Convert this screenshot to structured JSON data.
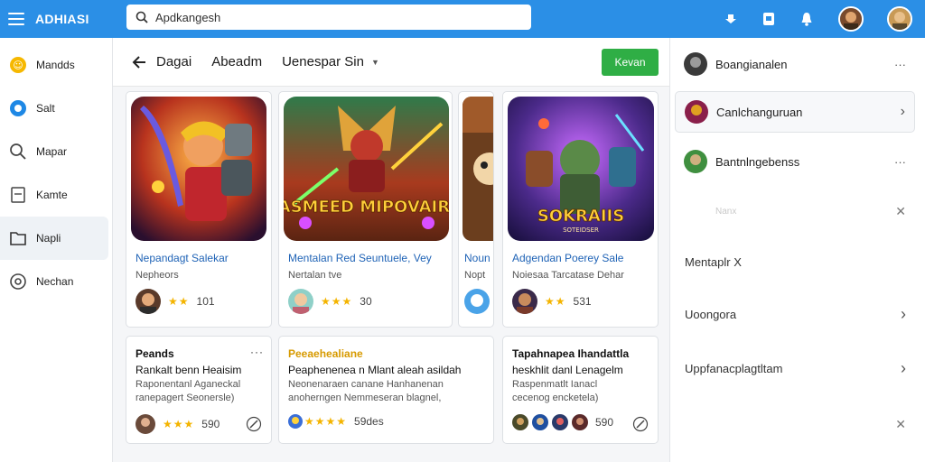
{
  "app": {
    "title": "ADHIASI"
  },
  "search": {
    "value": "Apdkangesh"
  },
  "sidebar": {
    "items": [
      {
        "label": "Mandds",
        "icon": "coin-icon"
      },
      {
        "label": "Salt",
        "icon": "compass-icon"
      },
      {
        "label": "Mapar",
        "icon": "search-icon"
      },
      {
        "label": "Kamte",
        "icon": "document-icon"
      },
      {
        "label": "Napli",
        "icon": "folder-icon"
      },
      {
        "label": "Nechan",
        "icon": "target-icon"
      }
    ]
  },
  "header": {
    "tabs": [
      "Dagai",
      "Abeadm",
      "Uenespar Sin"
    ],
    "cta": "Kevan"
  },
  "cards": [
    {
      "title": "Nepandagt Salekar",
      "subtitle": "Nepheors",
      "stars": "★★",
      "rating": "101"
    },
    {
      "title": "Mentalan Red Seuntuele, Vey",
      "subtitle": "Nertalan tve",
      "stars": "★★★",
      "rating": "30",
      "art_text": "JASMEED MIPOVAIRS"
    },
    {
      "title": "Noun",
      "subtitle": "Nopt",
      "stars": "",
      "rating": ""
    },
    {
      "title": "Adgendan Poerey Sale",
      "subtitle": "Noiesaa Tarcatase Dehar",
      "stars": "★★",
      "rating": "531",
      "art_text": "SOKRAIIS",
      "art_sub": "SOTEIDSER"
    }
  ],
  "posts": [
    {
      "title": "Peands",
      "line": "Rankalt benn Heaisim",
      "desc1": "Raponentanl Aganeckal",
      "desc2": "ranepagert Seonersle)",
      "stars": "★★★",
      "rating": "590"
    },
    {
      "title": "Peeaehealiane",
      "line": "Peaphenenea n Mlant aleah asildah",
      "desc1": "Neonenaraen canane Hanhanenan",
      "desc2": "anoherngen Nemmeseran blagnel,",
      "stars": "★★★★",
      "rating": "59des"
    },
    {
      "title": "Tapahnapea Ihandattla",
      "line": "heskhlit danl Lenagelm",
      "desc1": "Raspenmatlt Ianacl",
      "desc2": "cecenog encketela)",
      "stars": "",
      "rating": "590"
    }
  ],
  "right_panel": {
    "rows": [
      {
        "label": "Boangianalen",
        "action": "···"
      },
      {
        "label": "Canlchanguruan",
        "action": "›"
      },
      {
        "label": "Bantnlngebenss",
        "action": "···"
      }
    ],
    "muted": "Nanx",
    "items": [
      {
        "label": "Mentaplr X",
        "action": ""
      },
      {
        "label": "Uoongora",
        "action": "›"
      },
      {
        "label": "Uppfanacplagtltam",
        "action": "›"
      }
    ],
    "close": "✕"
  },
  "colors": {
    "topbar": "#2b8fe6",
    "accent_green": "#2fae45",
    "link_blue": "#1f63b6",
    "star": "#f4b400"
  }
}
